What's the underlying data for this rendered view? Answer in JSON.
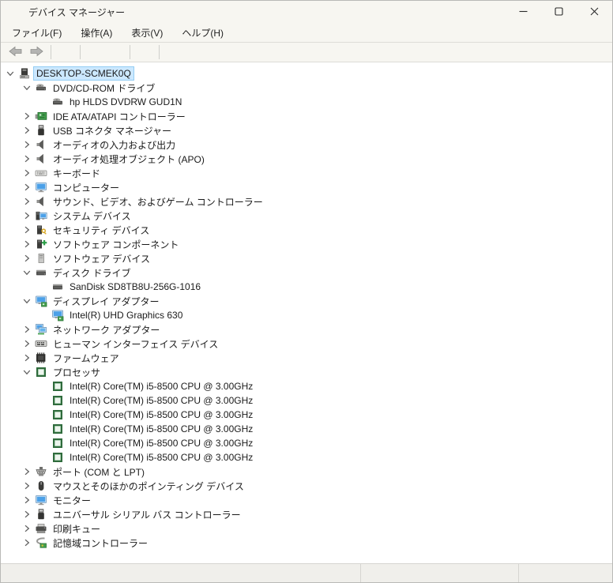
{
  "window": {
    "title": "デバイス マネージャー",
    "icon": "device-manager-icon",
    "controls": [
      {
        "name": "minimize-button",
        "icon": "minimize-icon"
      },
      {
        "name": "maximize-button",
        "icon": "maximize-icon"
      },
      {
        "name": "close-button",
        "icon": "close-icon"
      }
    ]
  },
  "menu": {
    "items": [
      {
        "label": "ファイル(F)"
      },
      {
        "label": "操作(A)"
      },
      {
        "label": "表示(V)"
      },
      {
        "label": "ヘルプ(H)"
      }
    ]
  },
  "toolbar": {
    "buttons": [
      {
        "name": "back-button",
        "icon": "back-arrow-icon"
      },
      {
        "name": "forward-button",
        "icon": "forward-arrow-icon"
      },
      {
        "name": "separator"
      },
      {
        "name": "show-console-tree-button",
        "icon": "console-tree-icon"
      },
      {
        "name": "separator"
      },
      {
        "name": "help-button",
        "icon": "help-icon"
      },
      {
        "name": "show-action-pane-button",
        "icon": "action-pane-icon"
      },
      {
        "name": "separator"
      },
      {
        "name": "scan-hardware-changes-button",
        "icon": "scan-hardware-icon"
      },
      {
        "name": "separator"
      },
      {
        "name": "remote-computer-button",
        "icon": "remote-monitor-icon"
      }
    ]
  },
  "tree": {
    "items": [
      {
        "label": "DESKTOP-SCMEK0Q",
        "icon": "computer-root-icon",
        "level": 0,
        "state": "expanded",
        "selected": true
      },
      {
        "label": "DVD/CD-ROM ドライブ",
        "icon": "cd-drive-icon",
        "level": 1,
        "state": "expanded"
      },
      {
        "label": "hp HLDS DVDRW  GUD1N",
        "icon": "cd-drive-icon",
        "level": 2,
        "state": "leaf"
      },
      {
        "label": "IDE ATA/ATAPI コントローラー",
        "icon": "ide-controller-icon",
        "level": 1,
        "state": "collapsed"
      },
      {
        "label": "USB コネクタ マネージャー",
        "icon": "usb-icon",
        "level": 1,
        "state": "collapsed"
      },
      {
        "label": "オーディオの入力および出力",
        "icon": "speaker-icon",
        "level": 1,
        "state": "collapsed"
      },
      {
        "label": "オーディオ処理オブジェクト (APO)",
        "icon": "speaker-icon",
        "level": 1,
        "state": "collapsed"
      },
      {
        "label": "キーボード",
        "icon": "keyboard-icon",
        "level": 1,
        "state": "collapsed"
      },
      {
        "label": "コンピューター",
        "icon": "monitor-icon",
        "level": 1,
        "state": "collapsed"
      },
      {
        "label": "サウンド、ビデオ、およびゲーム コントローラー",
        "icon": "speaker-icon",
        "level": 1,
        "state": "collapsed"
      },
      {
        "label": "システム デバイス",
        "icon": "system-devices-icon",
        "level": 1,
        "state": "collapsed"
      },
      {
        "label": "セキュリティ デバイス",
        "icon": "security-device-icon",
        "level": 1,
        "state": "collapsed"
      },
      {
        "label": "ソフトウェア コンポーネント",
        "icon": "software-component-icon",
        "level": 1,
        "state": "collapsed"
      },
      {
        "label": "ソフトウェア デバイス",
        "icon": "software-device-icon",
        "level": 1,
        "state": "collapsed"
      },
      {
        "label": "ディスク ドライブ",
        "icon": "disk-drive-icon",
        "level": 1,
        "state": "expanded"
      },
      {
        "label": "SanDisk SD8TB8U-256G-1016",
        "icon": "disk-drive-icon",
        "level": 2,
        "state": "leaf"
      },
      {
        "label": "ディスプレイ アダプター",
        "icon": "display-adapter-icon",
        "level": 1,
        "state": "expanded"
      },
      {
        "label": "Intel(R) UHD Graphics 630",
        "icon": "display-adapter-icon",
        "level": 2,
        "state": "leaf"
      },
      {
        "label": "ネットワーク アダプター",
        "icon": "network-adapter-icon",
        "level": 1,
        "state": "collapsed"
      },
      {
        "label": "ヒューマン インターフェイス デバイス",
        "icon": "hid-icon",
        "level": 1,
        "state": "collapsed"
      },
      {
        "label": "ファームウェア",
        "icon": "firmware-icon",
        "level": 1,
        "state": "collapsed"
      },
      {
        "label": "プロセッサ",
        "icon": "cpu-icon",
        "level": 1,
        "state": "expanded"
      },
      {
        "label": "Intel(R) Core(TM) i5-8500 CPU @ 3.00GHz",
        "icon": "cpu-icon",
        "level": 2,
        "state": "leaf"
      },
      {
        "label": "Intel(R) Core(TM) i5-8500 CPU @ 3.00GHz",
        "icon": "cpu-icon",
        "level": 2,
        "state": "leaf"
      },
      {
        "label": "Intel(R) Core(TM) i5-8500 CPU @ 3.00GHz",
        "icon": "cpu-icon",
        "level": 2,
        "state": "leaf"
      },
      {
        "label": "Intel(R) Core(TM) i5-8500 CPU @ 3.00GHz",
        "icon": "cpu-icon",
        "level": 2,
        "state": "leaf"
      },
      {
        "label": "Intel(R) Core(TM) i5-8500 CPU @ 3.00GHz",
        "icon": "cpu-icon",
        "level": 2,
        "state": "leaf"
      },
      {
        "label": "Intel(R) Core(TM) i5-8500 CPU @ 3.00GHz",
        "icon": "cpu-icon",
        "level": 2,
        "state": "leaf"
      },
      {
        "label": "ポート (COM と LPT)",
        "icon": "serial-port-icon",
        "level": 1,
        "state": "collapsed"
      },
      {
        "label": "マウスとそのほかのポインティング デバイス",
        "icon": "mouse-icon",
        "level": 1,
        "state": "collapsed"
      },
      {
        "label": "モニター",
        "icon": "monitor-icon",
        "level": 1,
        "state": "collapsed"
      },
      {
        "label": "ユニバーサル シリアル バス コントローラー",
        "icon": "usb-icon",
        "level": 1,
        "state": "collapsed"
      },
      {
        "label": "印刷キュー",
        "icon": "printer-icon",
        "level": 1,
        "state": "collapsed"
      },
      {
        "label": "記憶域コントローラー",
        "icon": "storage-controller-icon",
        "level": 1,
        "state": "collapsed"
      }
    ]
  },
  "statusbar": {
    "panes": [
      "",
      "",
      ""
    ]
  },
  "colors": {
    "selection_bg": "#cce8ff",
    "selection_border": "#94cdf3",
    "tree_bg": "#ffffff",
    "chrome_bg": "#f7f6f1",
    "status_bg": "#f0efeb",
    "accent_blue": "#4ba0e8",
    "accent_green": "#44a04e"
  }
}
